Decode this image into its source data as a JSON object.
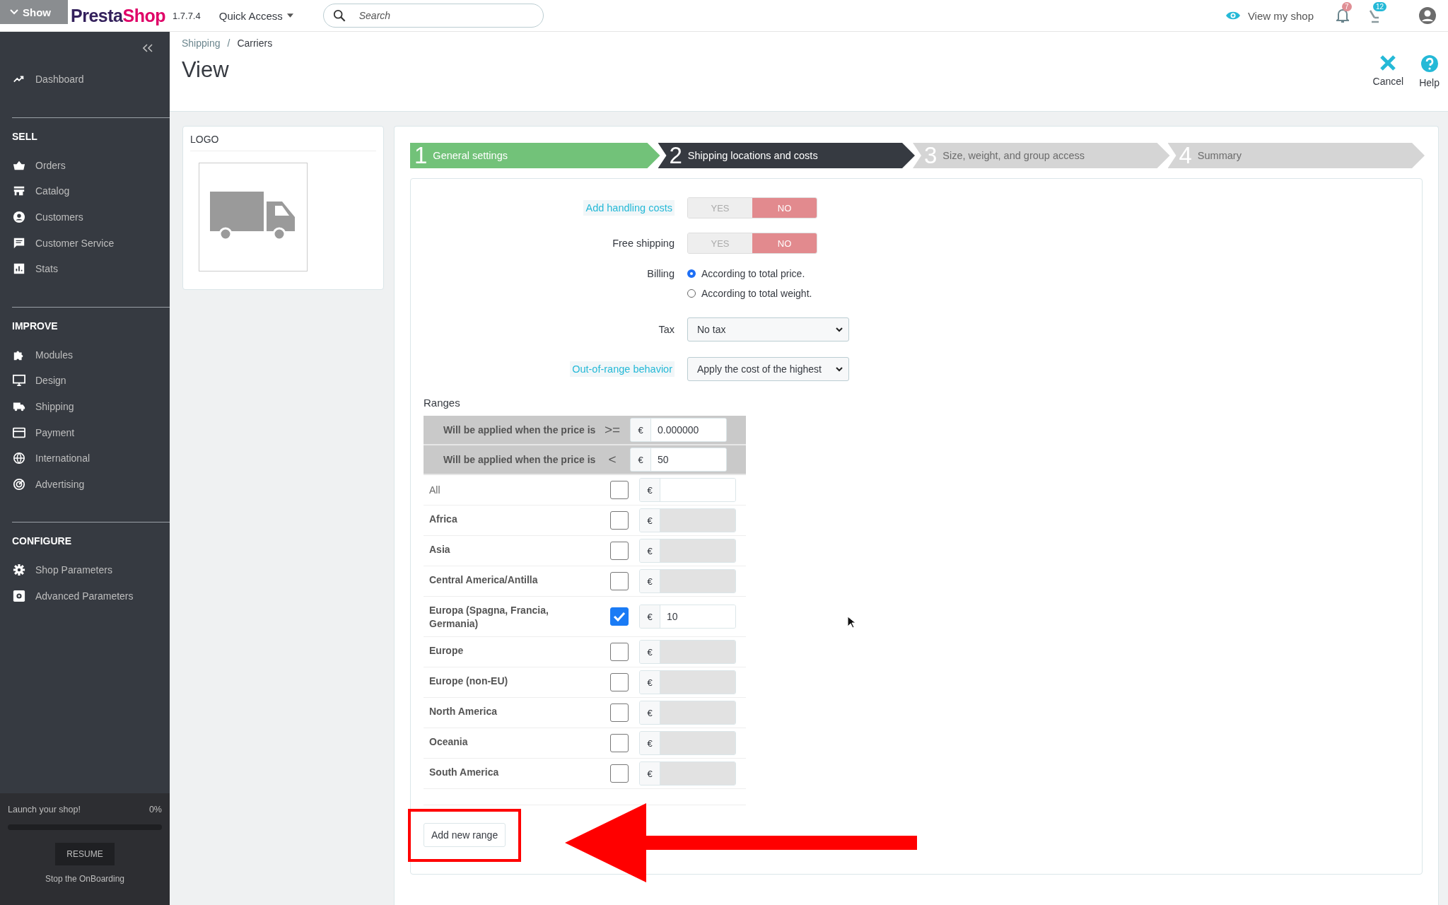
{
  "topbar": {
    "overlay_label": "Show",
    "logo": {
      "part_1": "Presta",
      "part_2": "Shop"
    },
    "version": "1.7.7.4",
    "quick_access": "Quick Access",
    "search": {
      "placeholder": "Search"
    },
    "view_shop": "View my shop",
    "notifications": "7",
    "orders": "12"
  },
  "sidebar": {
    "sections": [
      {
        "items": [
          {
            "label": "Dashboard"
          }
        ]
      },
      {
        "title": "SELL",
        "items": [
          {
            "label": "Orders"
          },
          {
            "label": "Catalog"
          },
          {
            "label": "Customers"
          },
          {
            "label": "Customer Service"
          },
          {
            "label": "Stats"
          }
        ]
      },
      {
        "title": "IMPROVE",
        "items": [
          {
            "label": "Modules"
          },
          {
            "label": "Design"
          },
          {
            "label": "Shipping"
          },
          {
            "label": "Payment"
          },
          {
            "label": "International"
          },
          {
            "label": "Advertising"
          }
        ]
      },
      {
        "title": "CONFIGURE",
        "items": [
          {
            "label": "Shop Parameters"
          },
          {
            "label": "Advanced Parameters"
          }
        ]
      }
    ],
    "onboarding": {
      "label": "Launch your shop!",
      "percent": "0%",
      "level": 0,
      "button": "RESUME",
      "link": "Stop the OnBoarding"
    }
  },
  "header": {
    "breadcrumb": [
      "Shipping",
      "Carriers"
    ],
    "breadcrumb_separator": "/",
    "title": "View",
    "actions": [
      {
        "kind": "cancel",
        "label": "Cancel"
      },
      {
        "kind": "help",
        "label": "Help"
      }
    ]
  },
  "logo_card": {
    "title": "LOGO"
  },
  "steps": [
    {
      "number": "1",
      "label": "General settings",
      "completed": true,
      "selected": false
    },
    {
      "number": "2",
      "label": "Shipping locations and costs",
      "completed": false,
      "selected": true
    },
    {
      "number": "3",
      "label": "Size, weight, and group access",
      "completed": false,
      "selected": false
    },
    {
      "number": "4",
      "label": "Summary",
      "completed": false,
      "selected": false
    }
  ],
  "form": [
    {
      "kind": "toggle",
      "label": "Add handling costs",
      "hint": true,
      "options": [
        {
          "label": "YES",
          "selected": false
        },
        {
          "label": "NO",
          "selected": true
        }
      ]
    },
    {
      "kind": "toggle",
      "label": "Free shipping",
      "hint": false,
      "options": [
        {
          "label": "YES",
          "selected": false
        },
        {
          "label": "NO",
          "selected": true
        }
      ]
    },
    {
      "kind": "radio",
      "label": "Billing",
      "hint": false,
      "options": [
        {
          "label": "According to total price.",
          "selected": true
        },
        {
          "label": "According to total weight.",
          "selected": false
        }
      ]
    },
    {
      "kind": "select",
      "label": "Tax",
      "hint": false,
      "value": "No tax"
    },
    {
      "kind": "select",
      "label": "Out-of-range behavior",
      "hint": true,
      "value": "Apply the cost of the highest"
    }
  ],
  "ranges": {
    "title": "Ranges",
    "bounds": [
      {
        "label": "Will be applied when the price is",
        "operator": ">=",
        "currency": "€",
        "value": "0.000000"
      },
      {
        "label": "Will be applied when the price is",
        "operator": "<",
        "currency": "€",
        "value": "50"
      }
    ],
    "zones": [
      {
        "kind": "all",
        "name": "All",
        "checked": false,
        "currency": "€",
        "disabled": false
      },
      {
        "kind": "zone",
        "name": "Africa",
        "checked": false,
        "currency": "€",
        "disabled": true
      },
      {
        "kind": "zone",
        "name": "Asia",
        "checked": false,
        "currency": "€",
        "disabled": true
      },
      {
        "kind": "zone",
        "name": "Central America/Antilla",
        "checked": false,
        "currency": "€",
        "disabled": true
      },
      {
        "kind": "zone",
        "name": "Europa (Spagna, Francia, Germania)",
        "checked": true,
        "currency": "€",
        "value": "10",
        "disabled": false
      },
      {
        "kind": "zone",
        "name": "Europe",
        "checked": false,
        "currency": "€",
        "disabled": true
      },
      {
        "kind": "zone",
        "name": "Europe (non-EU)",
        "checked": false,
        "currency": "€",
        "disabled": true
      },
      {
        "kind": "zone",
        "name": "North America",
        "checked": false,
        "currency": "€",
        "disabled": true
      },
      {
        "kind": "zone",
        "name": "Oceania",
        "checked": false,
        "currency": "€",
        "disabled": true
      },
      {
        "kind": "zone",
        "name": "South America",
        "checked": false,
        "currency": "€",
        "disabled": true
      }
    ],
    "add_button": "Add new range"
  }
}
